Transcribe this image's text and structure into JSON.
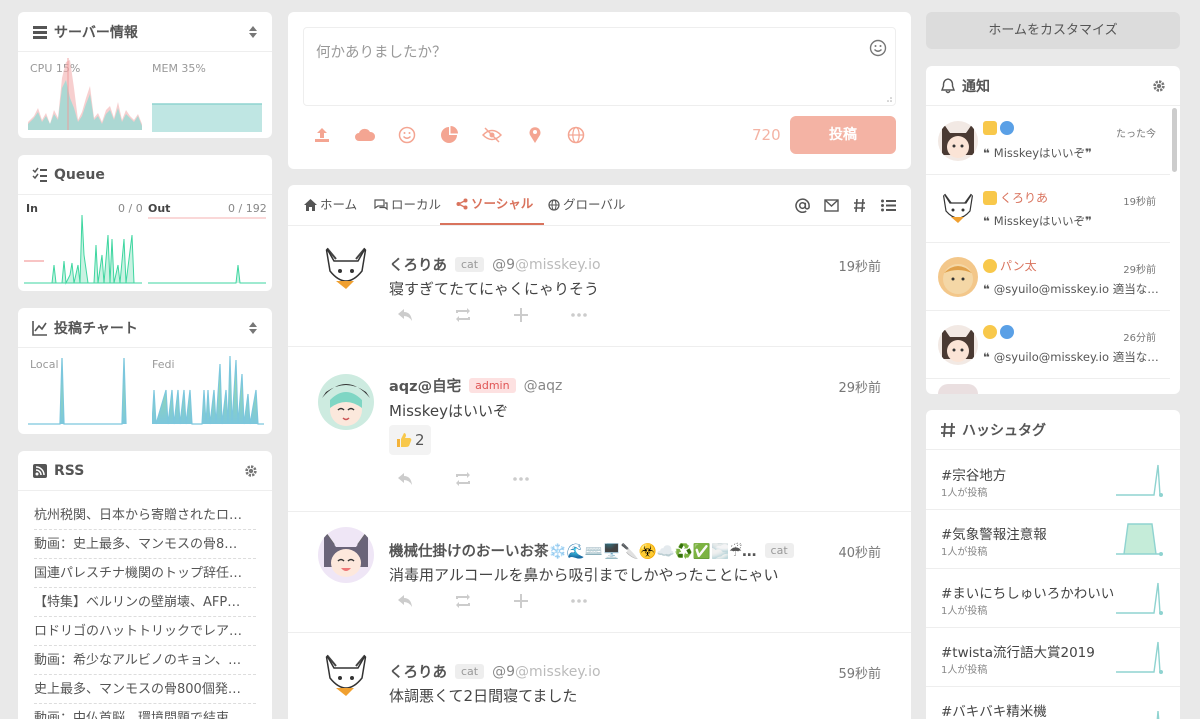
{
  "server_info": {
    "title": "サーバー情報",
    "cpu_label": "CPU 15%",
    "mem_label": "MEM 35%"
  },
  "queue": {
    "title": "Queue",
    "in_label": "In",
    "in_value": "0 / 0",
    "out_label": "Out",
    "out_value": "0 / 192"
  },
  "post_chart": {
    "title": "投稿チャート",
    "local_label": "Local",
    "fedi_label": "Fedi"
  },
  "rss": {
    "title": "RSS",
    "items": [
      "杭州税関、日本から寄贈されたロ…",
      "動画：史上最多、マンモスの骨8…",
      "国連パレスチナ機関のトップ辞任…",
      "【特集】ベルリンの壁崩壊、AFP…",
      "ロドリゴのハットトリックでレア…",
      "動画：希少なアルビノのキョン、…",
      "史上最多、マンモスの骨800個発…",
      "動画：中仏首脳、環境問題で結束…"
    ]
  },
  "composer": {
    "placeholder": "何かありましたか？",
    "char_count": "720",
    "post_label": "投稿"
  },
  "timeline": {
    "tabs": [
      {
        "label": "ホーム"
      },
      {
        "label": "ローカル"
      },
      {
        "label": "ソーシャル"
      },
      {
        "label": "グローバル"
      }
    ],
    "notes": [
      {
        "name": "くろりあ",
        "badge": "cat",
        "username": "@9",
        "host": "@misskey.io",
        "time": "19秒前",
        "text": "寝すぎてたてにゃくにゃりそう"
      },
      {
        "name": "aqz@自宅",
        "badge": "admin",
        "username": "@aqz",
        "host": "",
        "time": "29秒前",
        "text": "Misskeyはいいぞ",
        "reaction_count": "2"
      },
      {
        "name": "機械仕掛けのおーいお茶❄️🌊⌨️🖥️🔪☣️☁️♻️✅🌫️☔…",
        "badge": "cat",
        "username": "",
        "host": "",
        "time": "40秒前",
        "text": "消毒用アルコールを鼻から吸引までしかやったことにゃい"
      },
      {
        "name": "くろりあ",
        "badge": "cat",
        "username": "@9",
        "host": "@misskey.io",
        "time": "59秒前",
        "text": "体調悪くて2日間寝てました"
      }
    ]
  },
  "customize_label": "ホームをカスタマイズ",
  "notifications": {
    "title": "通知",
    "items": [
      {
        "user": "",
        "time": "たった今",
        "text": "Misskeyはいいぞ"
      },
      {
        "user": "くろりあ",
        "time": "19秒前",
        "text": "Misskeyはいいぞ"
      },
      {
        "user": "パン太",
        "time": "29秒前",
        "text": "@syuilo@misskey.io 適当なR…"
      },
      {
        "user": "",
        "time": "26分前",
        "text": "@syuilo@misskey.io 適当なR…"
      }
    ]
  },
  "hashtags": {
    "title": "ハッシュタグ",
    "items": [
      {
        "tag": "#宗谷地方",
        "count": "1人が投稿"
      },
      {
        "tag": "#気象警報注意報",
        "count": "1人が投稿"
      },
      {
        "tag": "#まいにちしゅいろかわいい",
        "count": "1人が投稿"
      },
      {
        "tag": "#twista流行語大賞2019",
        "count": "1人が投稿"
      },
      {
        "tag": "#バキバキ精米機",
        "count": ""
      }
    ]
  },
  "colors": {
    "accent": "#d9735d",
    "post_button": "#f4b3a4",
    "chart_teal": "#8fd3d0",
    "chart_green": "#3ed6a0"
  }
}
